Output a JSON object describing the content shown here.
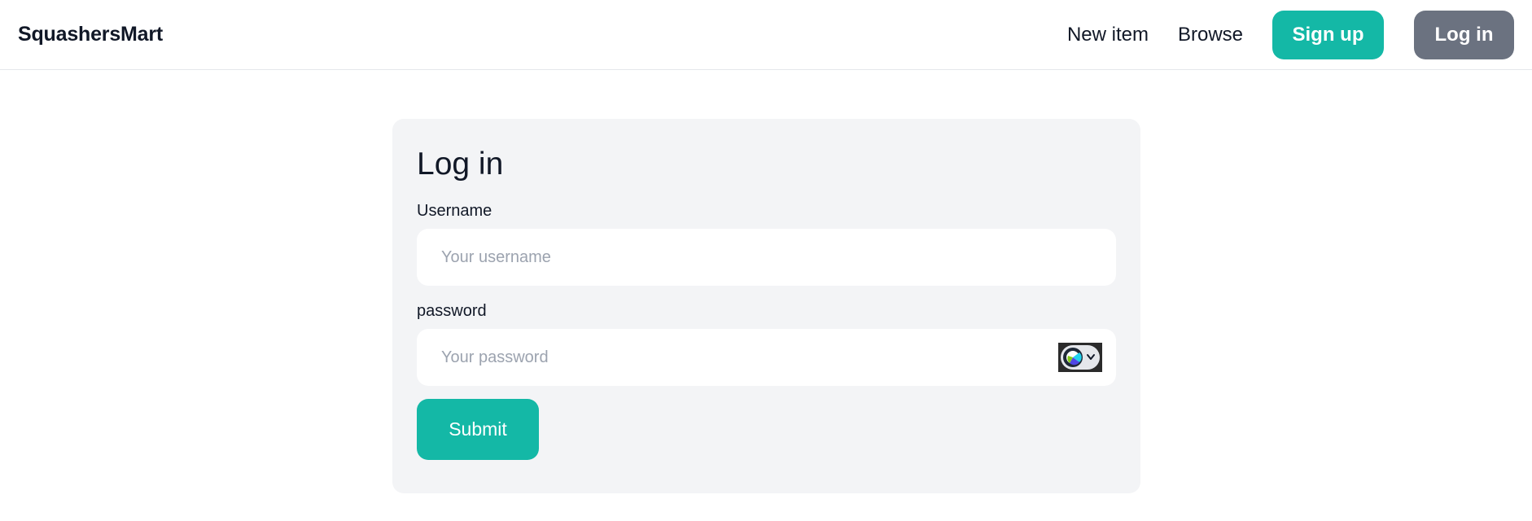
{
  "navbar": {
    "brand": "SquashersMart",
    "links": {
      "new_item": "New item",
      "browse": "Browse"
    },
    "signup_label": "Sign up",
    "login_label": "Log in"
  },
  "login_form": {
    "title": "Log in",
    "username_label": "Username",
    "username_placeholder": "Your username",
    "password_label": "password",
    "password_placeholder": "Your password",
    "submit_label": "Submit",
    "password_extension_icon": "password-manager-icon"
  },
  "colors": {
    "accent": "#14b8a6",
    "secondary_button": "#6b7280",
    "card_background": "#f3f4f6",
    "placeholder": "#9ca3af"
  }
}
